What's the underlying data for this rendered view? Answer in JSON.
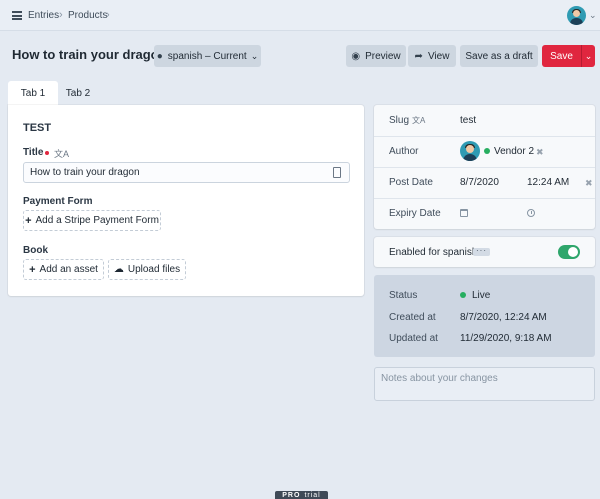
{
  "topbar": {
    "breadcrumbs": [
      "Entries",
      "Products"
    ],
    "icons": [
      "menu-icon",
      "chevron-right-icon",
      "avatar",
      "chevron-down-icon"
    ]
  },
  "header": {
    "title": "How to train your dragon",
    "locale_label": "spanish – Current",
    "buttons": {
      "preview": "Preview",
      "view": "View",
      "save_draft": "Save as a draft",
      "save": "Save"
    },
    "colors": {
      "save": "#e0263f"
    }
  },
  "tabs": [
    {
      "label": "Tab 1",
      "active": true
    },
    {
      "label": "Tab 2",
      "active": false
    }
  ],
  "main": {
    "section_title": "TEST",
    "title_field": {
      "label": "Title",
      "value": "How to train your dragon",
      "required": true
    },
    "payment_form": {
      "label": "Payment Form",
      "button": "Add a Stripe Payment Form"
    },
    "book": {
      "label": "Book",
      "add_asset": "Add an asset",
      "upload": "Upload files"
    }
  },
  "sidebar": {
    "slug": {
      "label": "Slug",
      "value": "test"
    },
    "author": {
      "label": "Author",
      "value": "Vendor 2"
    },
    "post_date": {
      "label": "Post Date",
      "date": "8/7/2020",
      "time": "12:24 AM"
    },
    "expiry_date": {
      "label": "Expiry Date"
    },
    "enabled": {
      "label": "Enabled for spanish",
      "on": true
    },
    "meta": {
      "status_label": "Status",
      "status_value": "Live",
      "created_label": "Created at",
      "created_value": "8/7/2020, 12:24 AM",
      "updated_label": "Updated at",
      "updated_value": "11/29/2020, 9:18 AM"
    },
    "notes_placeholder": "Notes about your changes"
  },
  "footer": {
    "badge_pro": "PRO",
    "badge_trial": "trial"
  }
}
